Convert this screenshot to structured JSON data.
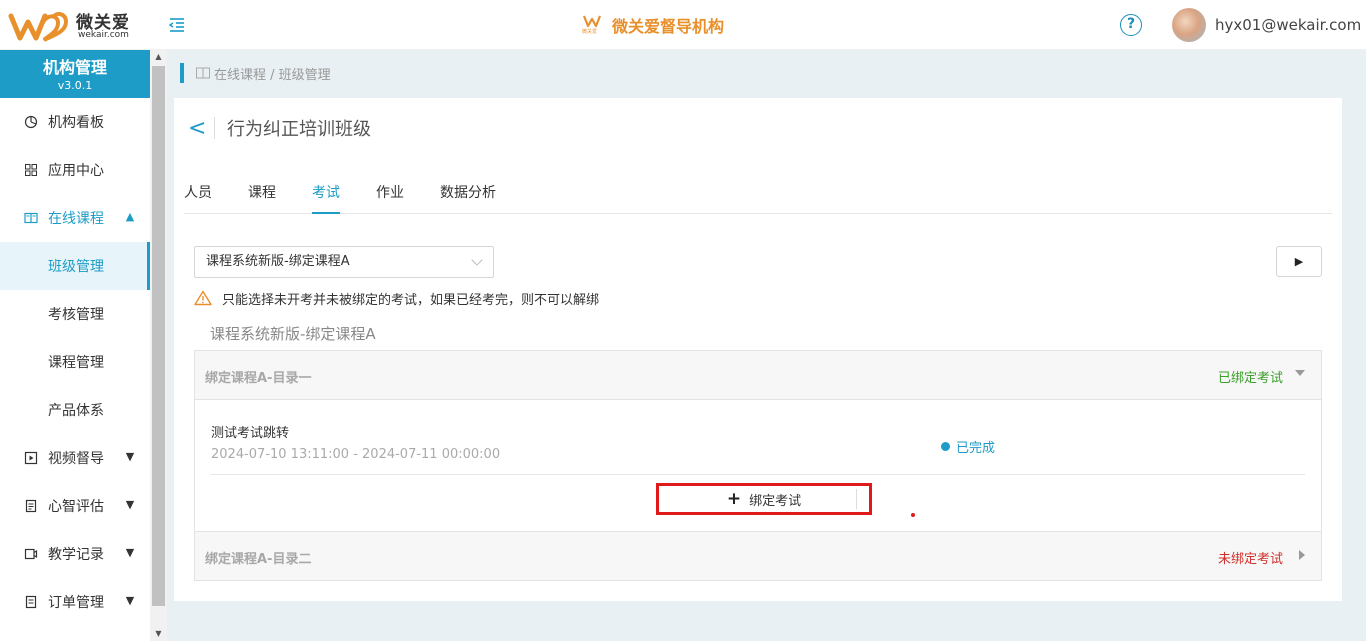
{
  "header": {
    "logo_text": "微关爱",
    "logo_sub": "wekair.com",
    "mini_logo_text": "微关爱",
    "brand_title": "微关爱督导机构",
    "help_glyph": "?",
    "username": "hyx01@wekair.com"
  },
  "sidebar": {
    "title": "机构管理",
    "version": "v3.0.1",
    "items": [
      {
        "label": "机构看板",
        "icon": "pie-chart-icon"
      },
      {
        "label": "应用中心",
        "icon": "grid-icon"
      },
      {
        "label": "在线课程",
        "icon": "book-icon",
        "expanded": true
      },
      {
        "label": "班级管理",
        "sub": true,
        "active": true
      },
      {
        "label": "考核管理",
        "sub": true
      },
      {
        "label": "课程管理",
        "sub": true
      },
      {
        "label": "产品体系",
        "sub": true
      },
      {
        "label": "视频督导",
        "icon": "video-icon"
      },
      {
        "label": "心智评估",
        "icon": "clipboard-icon"
      },
      {
        "label": "教学记录",
        "icon": "record-icon"
      },
      {
        "label": "订单管理",
        "icon": "order-icon"
      }
    ]
  },
  "breadcrumb": {
    "text": "在线课程 / 班级管理"
  },
  "page": {
    "title": "行为纠正培训班级",
    "tabs": [
      {
        "label": "人员",
        "active": false
      },
      {
        "label": "课程",
        "active": false
      },
      {
        "label": "考试",
        "active": true
      },
      {
        "label": "作业",
        "active": false
      },
      {
        "label": "数据分析",
        "active": false
      }
    ],
    "course_select_value": "课程系统新版-绑定课程A",
    "warning": "只能选择未开考并未被绑定的考试，如果已经考完，则不可以解绑",
    "group_title": "课程系统新版-绑定课程A",
    "sections": [
      {
        "name": "绑定课程A-目录一",
        "status": "已绑定考试",
        "status_color": "#3aa02a",
        "expanded": true,
        "exam": {
          "name": "测试考试跳转",
          "time": "2024-07-10 13:11:00 - 2024-07-11 00:00:00",
          "status": "已完成"
        },
        "bind_label": "绑定考试"
      },
      {
        "name": "绑定课程A-目录二",
        "status": "未绑定考试",
        "status_color": "#d0302a",
        "expanded": false
      }
    ]
  },
  "colors": {
    "accent": "#1d9cc7",
    "brand_orange": "#e8902c",
    "highlight_red": "#e01a1a"
  }
}
